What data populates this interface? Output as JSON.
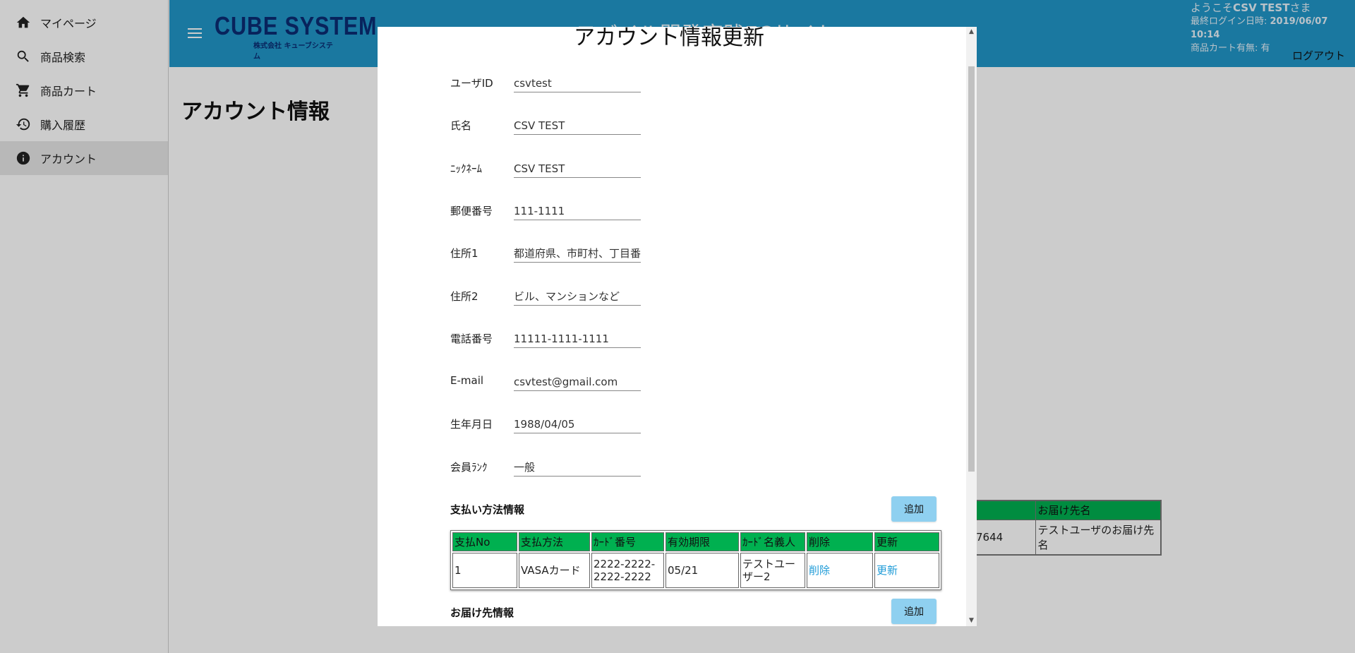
{
  "sidebar": {
    "items": [
      {
        "label": "マイページ",
        "icon": "home-icon"
      },
      {
        "label": "商品検索",
        "icon": "search-icon"
      },
      {
        "label": "商品カート",
        "icon": "cart-icon"
      },
      {
        "label": "購入履歴",
        "icon": "history-icon"
      },
      {
        "label": "アカウント",
        "icon": "info-icon",
        "active": true
      }
    ]
  },
  "header": {
    "logo_main": "CUBE SYSTEM",
    "logo_sub": "株式会社 キューブシステム",
    "site_title": "モバイル開発実践ECサイト",
    "welcome_prefix": "ようこそ",
    "user_name": "CSV TEST",
    "welcome_suffix": "さま",
    "last_login_label": "最終ログイン日時: ",
    "last_login_value": "2019/06/07 10:14",
    "cart_status_label": "商品カート有無: ",
    "cart_status_value": "有",
    "logout_label": "ログアウト",
    "color": "#2196c9"
  },
  "main": {
    "title": "アカウント情報",
    "delivery_table": {
      "headers": [
        "",
        "お届け先名"
      ],
      "row": [
        "7644",
        "テストユーザのお届け先名"
      ]
    }
  },
  "modal": {
    "title": "アカウント情報更新",
    "fields": [
      {
        "label": "ユーザID",
        "value": "csvtest"
      },
      {
        "label": "氏名",
        "value": "CSV TEST"
      },
      {
        "label": "ﾆｯｸﾈｰﾑ",
        "value": "CSV TEST"
      },
      {
        "label": "郵便番号",
        "value": "111-1111"
      },
      {
        "label": "住所1",
        "value": "都道府県、市町村、丁目番地"
      },
      {
        "label": "住所2",
        "value": "ビル、マンションなど"
      },
      {
        "label": "電話番号",
        "value": "11111-1111-1111"
      },
      {
        "label": "E-mail",
        "value": "csvtest@gmail.com"
      },
      {
        "label": "生年月日",
        "value": "1988/04/05"
      },
      {
        "label": "会員ﾗﾝｸ",
        "value": "一般"
      }
    ],
    "payment_section": {
      "heading": "支払い方法情報",
      "add_label": "追加",
      "headers": [
        "支払No",
        "支払方法",
        "ｶｰﾄﾞ番号",
        "有効期限",
        "ｶｰﾄﾞ名義人",
        "削除",
        "更新"
      ],
      "rows": [
        {
          "no": "1",
          "method": "VASAカード",
          "card_number": "2222-2222-2222-2222",
          "expiry": "05/21",
          "holder": "テストユーザー2",
          "delete_label": "削除",
          "update_label": "更新"
        }
      ]
    },
    "delivery_section": {
      "heading": "お届け先情報",
      "add_label": "追加"
    }
  },
  "colors": {
    "table_header": "#00b050",
    "link": "#1e9bd7",
    "add_button": "#8fd0f0"
  }
}
